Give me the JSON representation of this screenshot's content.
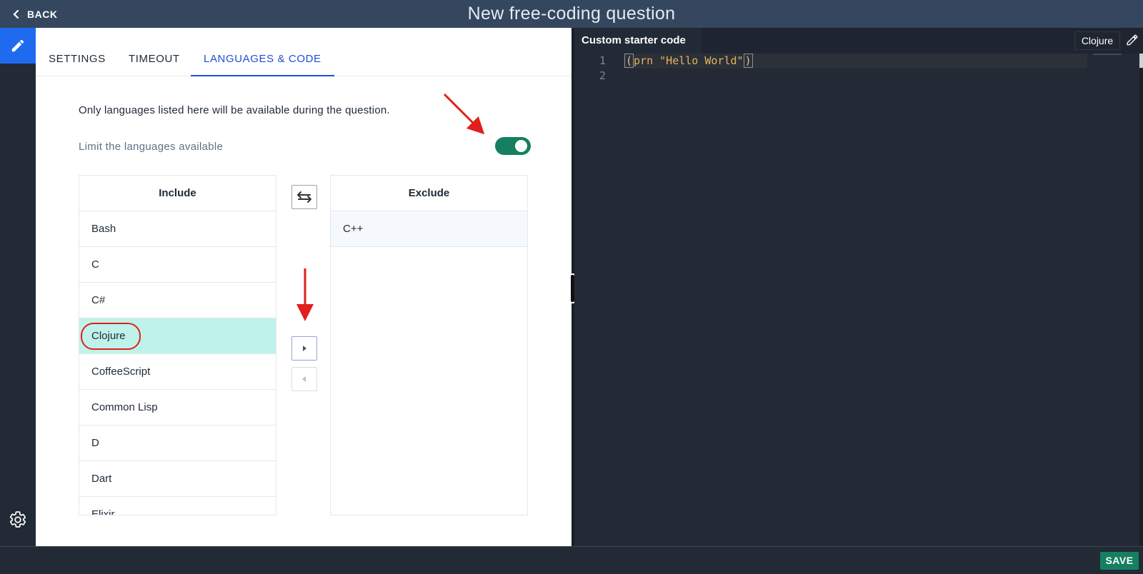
{
  "header": {
    "back_label": "BACK",
    "title": "New free-coding question"
  },
  "tabs": [
    {
      "label": "SETTINGS"
    },
    {
      "label": "TIMEOUT"
    },
    {
      "label": "LANGUAGES & CODE"
    }
  ],
  "active_tab": "LANGUAGES & CODE",
  "languages": {
    "info": "Only languages listed here will be available during the question.",
    "limit_label": "Limit the languages available",
    "limit_enabled": true,
    "include_header": "Include",
    "exclude_header": "Exclude",
    "include": [
      "Bash",
      "C",
      "C#",
      "Clojure",
      "CoffeeScript",
      "Common Lisp",
      "D",
      "Dart",
      "Elixir"
    ],
    "selected_include": "Clojure",
    "exclude": [
      "C++"
    ]
  },
  "editor": {
    "tab_label": "Custom starter code",
    "language": "Clojure",
    "line_numbers": [
      "1",
      "2"
    ],
    "code_lines": [
      "(prn \"Hello World\")",
      ""
    ],
    "code_parts": {
      "open": "(",
      "body": "prn \"Hello World\"",
      "close": ")"
    }
  },
  "footer": {
    "save_label": "SAVE"
  },
  "colors": {
    "accent_blue": "#1e4ed8",
    "toggle_green": "#157f5f",
    "selected_row": "#bff2ea",
    "annotation_red": "#e0201b"
  },
  "icons": [
    "chevron-left-icon",
    "pencil-icon",
    "gear-icon",
    "swap-arrows-icon",
    "caret-right-icon",
    "caret-left-icon",
    "edit-pencil-icon"
  ]
}
